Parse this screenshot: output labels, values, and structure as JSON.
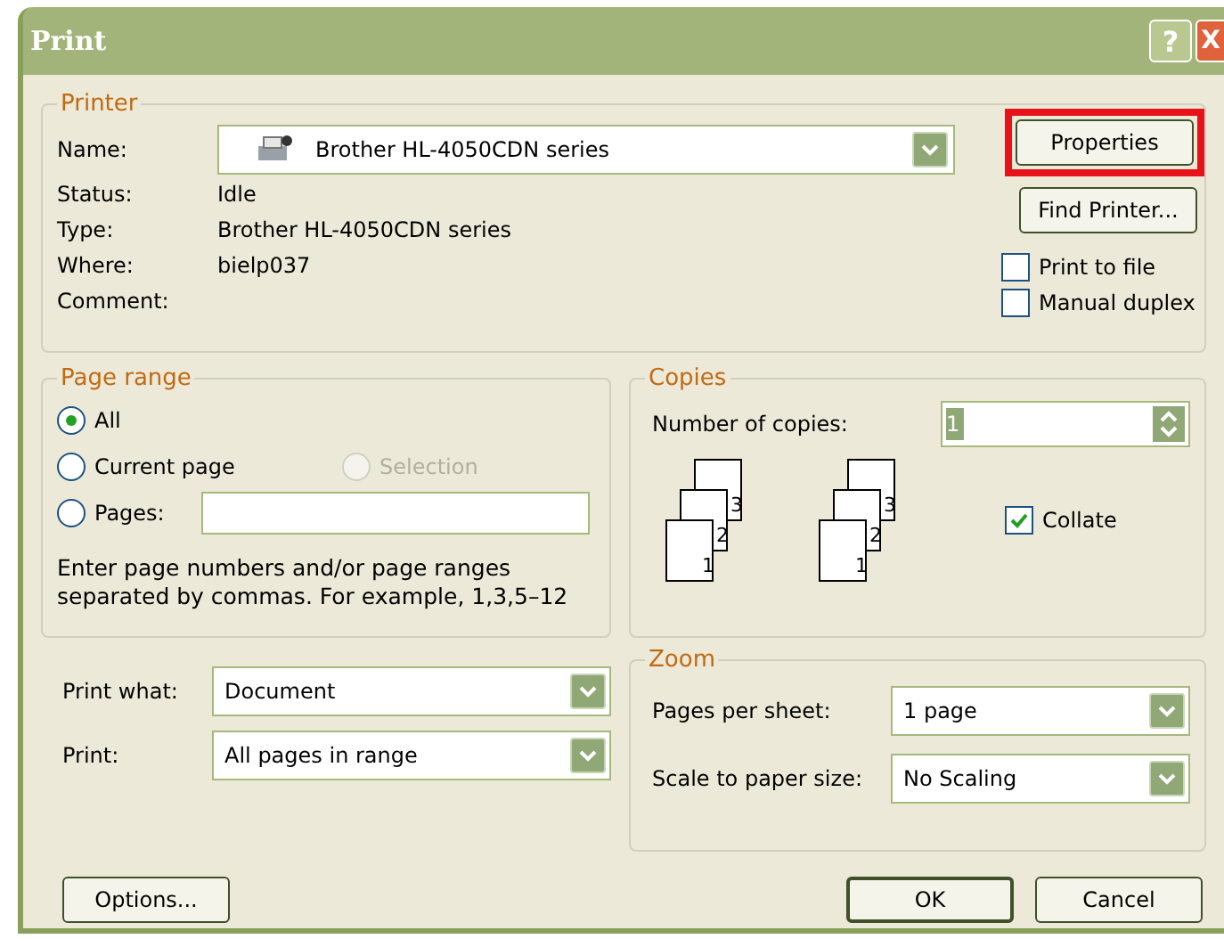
{
  "window": {
    "title": "Print",
    "controls": [
      "?",
      "X"
    ]
  },
  "printer": {
    "legend": "Printer",
    "name_label": "Name:",
    "name_value": "Brother HL-4050CDN series",
    "fields": [
      {
        "label": "Status:",
        "value": "Idle"
      },
      {
        "label": "Type:",
        "value": "Brother HL-4050CDN series"
      },
      {
        "label": "Where:",
        "value": "bielp037"
      },
      {
        "label": "Comment:"
      }
    ],
    "buttons": [
      {
        "label": "Properties",
        "highlighted": true
      },
      {
        "label": "Find Printer...",
        "highlighted": false
      }
    ],
    "options": [
      {
        "label": "Print to file",
        "checked": false
      },
      {
        "label": "Manual duplex",
        "checked": false
      }
    ]
  },
  "page_range": {
    "legend": "Page range",
    "options": [
      {
        "label": "All",
        "selected": true,
        "disabled": false
      },
      {
        "label": "Current page",
        "selected": false,
        "disabled": false
      },
      {
        "label": "Selection",
        "selected": false,
        "disabled": true
      },
      {
        "label": "Pages:",
        "selected": false,
        "disabled": false
      }
    ],
    "hint": "Enter page numbers and/or page ranges separated by commas.  For example, 1,3,5–12"
  },
  "copies": {
    "legend": "Copies",
    "label": "Number of copies:",
    "value": "1",
    "stacks": [
      [
        "3",
        "2",
        "1"
      ],
      [
        "3",
        "2",
        "1"
      ]
    ],
    "collate": {
      "label": "Collate",
      "checked": true
    }
  },
  "print_what": [
    {
      "label": "Print what:",
      "value": "Document"
    },
    {
      "label": "Print:",
      "value": "All pages in range"
    }
  ],
  "zoom": {
    "legend": "Zoom",
    "rows": [
      {
        "label": "Pages per sheet:",
        "value": "1 page"
      },
      {
        "label": "Scale to paper size:",
        "value": "No Scaling"
      }
    ]
  },
  "footer": {
    "options": "Options...",
    "ok": "OK",
    "cancel": "Cancel"
  }
}
